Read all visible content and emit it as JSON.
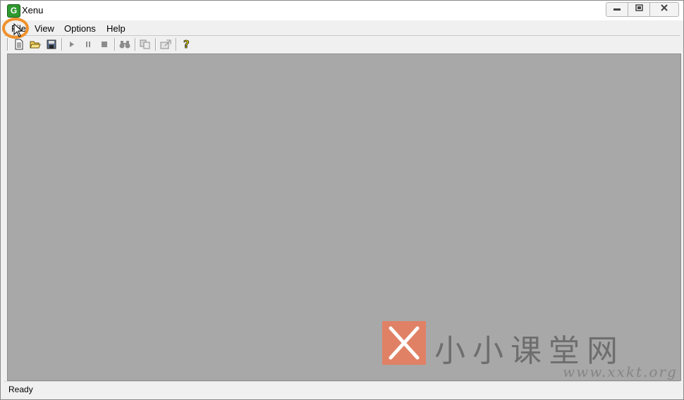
{
  "window": {
    "title": "Xenu",
    "app_icon_glyph": "G"
  },
  "menu": [
    {
      "label": "File"
    },
    {
      "label": "View"
    },
    {
      "label": "Options"
    },
    {
      "label": "Help"
    }
  ],
  "toolbar": {
    "icons": [
      "new-document-icon",
      "open-folder-icon",
      "save-icon",
      "play-icon",
      "pause-icon",
      "stop-icon",
      "find-binoculars-icon",
      "copy-icon",
      "properties-icon",
      "help-icon"
    ]
  },
  "status": {
    "text": "Ready"
  },
  "watermark": {
    "text": "小小课堂网",
    "url": "www.xxkt.org"
  },
  "colors": {
    "client_bg": "#a8a8a8",
    "highlight_ring": "#f0912b",
    "watermark_box": "#e08165"
  }
}
